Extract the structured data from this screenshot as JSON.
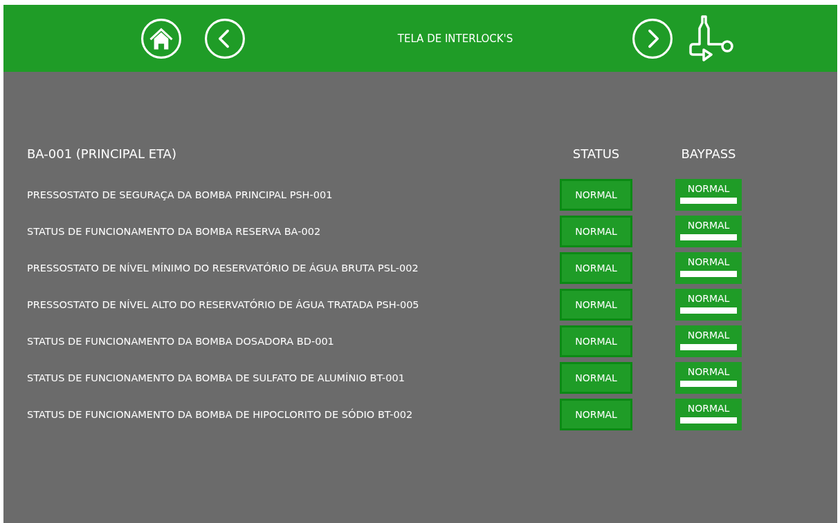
{
  "header": {
    "title": "TELA DE INTERLOCK'S"
  },
  "section": {
    "title": "BA-001 (PRINCIPAL ETA)",
    "status_heading": "STATUS",
    "bypass_heading": "BAYPASS"
  },
  "rows": [
    {
      "label": "PRESSOSTATO DE SEGURAÇA DA BOMBA PRINCIPAL PSH-001",
      "status": "NORMAL",
      "bypass": "NORMAL"
    },
    {
      "label": "STATUS DE FUNCIONAMENTO DA BOMBA RESERVA BA-002",
      "status": "NORMAL",
      "bypass": "NORMAL"
    },
    {
      "label": "PRESSOSTATO DE NÍVEL MÍNIMO DO RESERVATÓRIO DE ÁGUA BRUTA PSL-002",
      "status": "NORMAL",
      "bypass": "NORMAL"
    },
    {
      "label": "PRESSOSTATO DE NÍVEL ALTO DO RESERVATÓRIO DE ÁGUA TRATADA PSH-005",
      "status": "NORMAL",
      "bypass": "NORMAL"
    },
    {
      "label": "STATUS DE FUNCIONAMENTO DA BOMBA DOSADORA BD-001",
      "status": "NORMAL",
      "bypass": "NORMAL"
    },
    {
      "label": "STATUS DE FUNCIONAMENTO DA BOMBA DE SULFATO DE ALUMÍNIO BT-001",
      "status": "NORMAL",
      "bypass": "NORMAL"
    },
    {
      "label": "STATUS DE FUNCIONAMENTO DA BOMBA DE HIPOCLORITO DE SÓDIO BT-002",
      "status": "NORMAL",
      "bypass": "NORMAL"
    }
  ]
}
